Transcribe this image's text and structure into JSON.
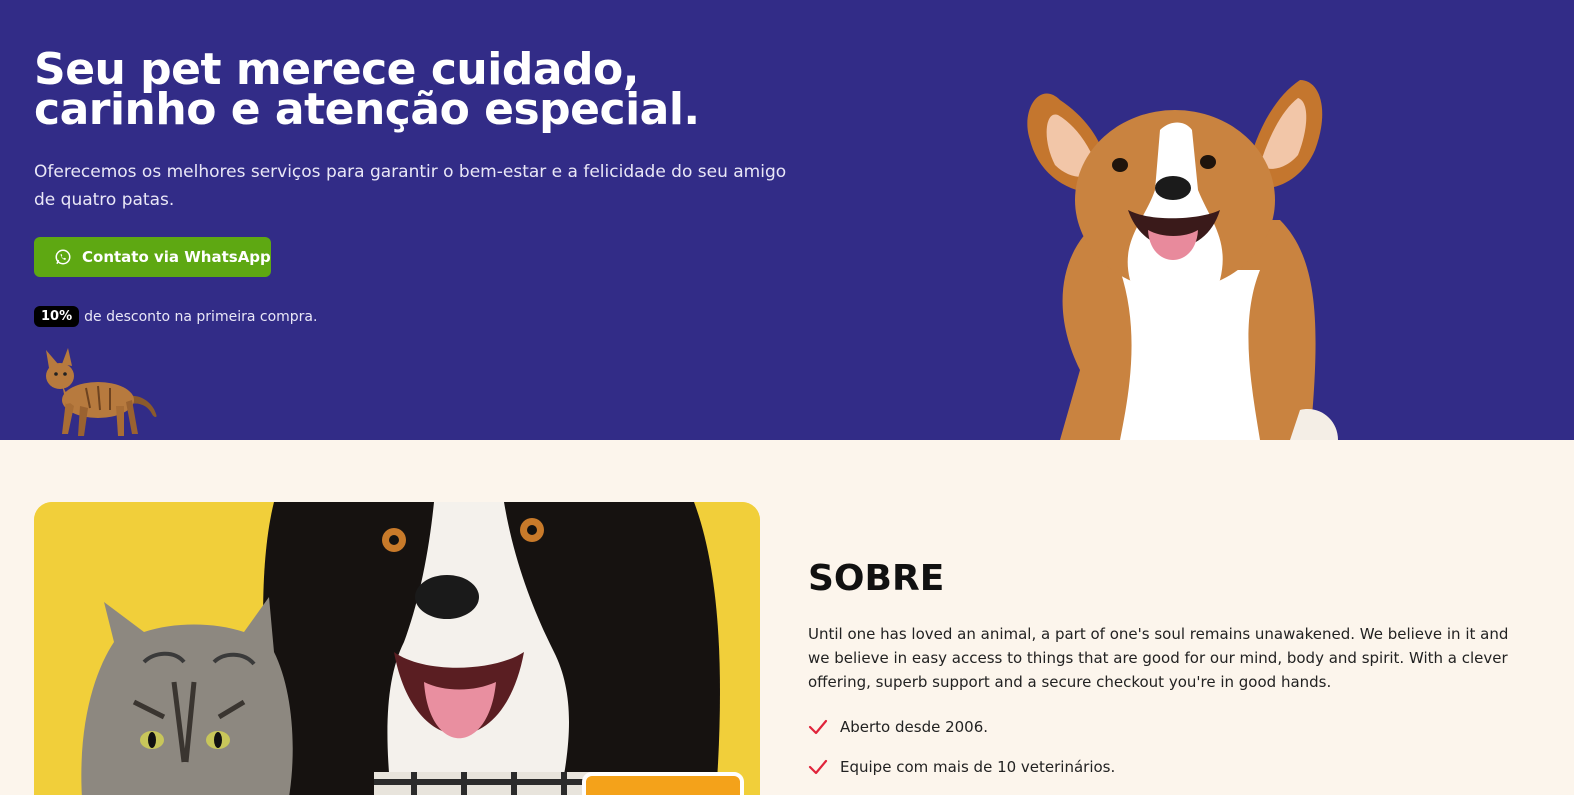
{
  "hero": {
    "title": "Seu pet merece cuidado, carinho e atenção especial.",
    "subtitle": "Oferecemos os melhores serviços para garantir o bem-estar e a felicidade do seu amigo de quatro patas.",
    "cta_label": "Contato via WhatsApp",
    "cta_icon": "whatsapp-icon",
    "discount_badge": "10%",
    "discount_text": "de desconto na primeira compra.",
    "colors": {
      "background": "#322c87",
      "cta": "#5ea812"
    }
  },
  "about": {
    "title": "SOBRE",
    "text": "Until one has loved an animal, a part of one's soul remains unawakened. We believe in it and we believe in easy access to things that are good for our mind, body and spirit. With a clever offering, superb support and a secure checkout you're in good hands.",
    "features": [
      {
        "label": "Aberto desde 2006.",
        "icon": "check-icon"
      },
      {
        "label": "Equipe com mais de 10 veterinários.",
        "icon": "check-icon"
      }
    ],
    "colors": {
      "background": "#fcf5ec",
      "check": "#e0243b",
      "photo_bg": "#f1cf3a"
    }
  }
}
